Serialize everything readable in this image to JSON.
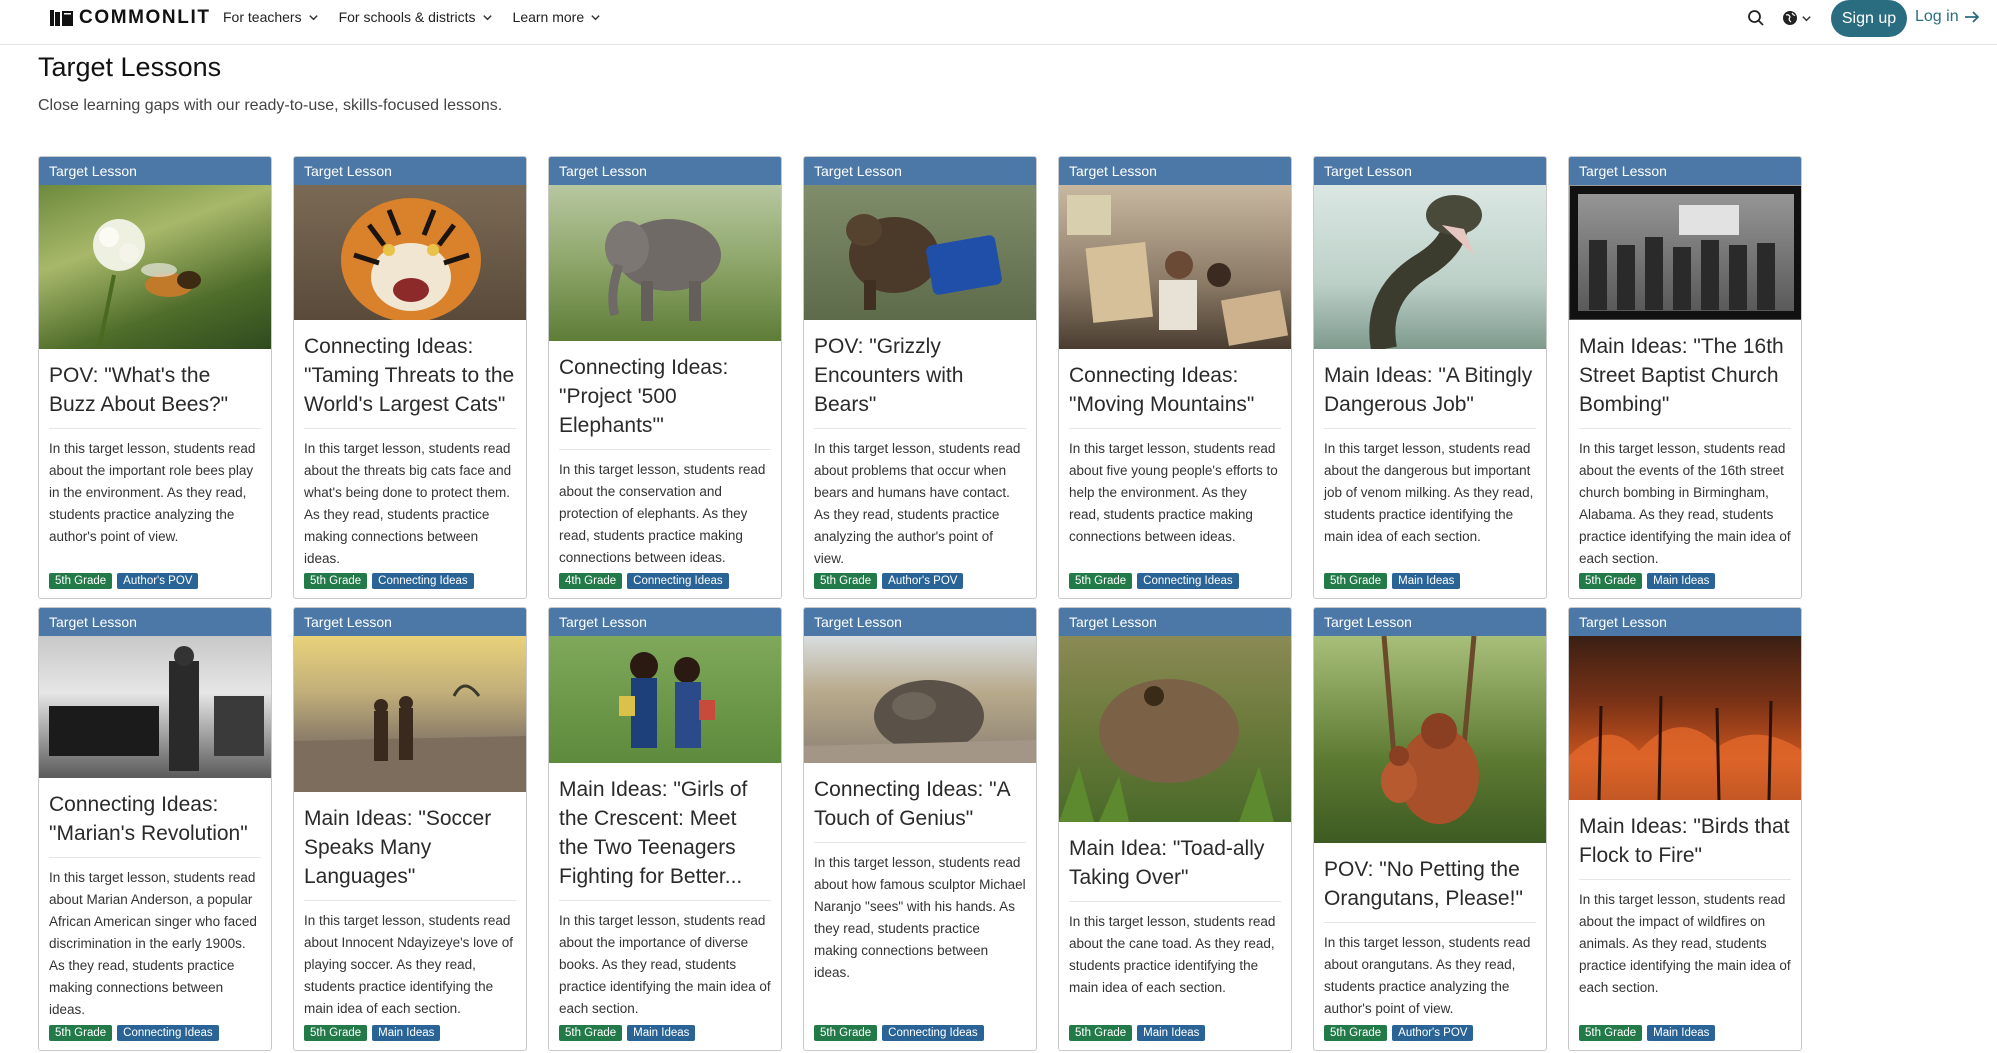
{
  "header": {
    "logo_text": "COMMONLIT",
    "nav": [
      {
        "label": "For teachers"
      },
      {
        "label": "For schools & districts"
      },
      {
        "label": "Learn more"
      }
    ],
    "signup_label": "Sign up",
    "login_label": "Log in"
  },
  "page": {
    "title": "Target Lessons",
    "subtitle": "Close learning gaps with our ready-to-use, skills-focused lessons."
  },
  "colors": {
    "accent": "#2b6d80",
    "card_label_bg": "#4b78a6",
    "grade_tag": "#227a49",
    "skill_tag": "#2a6497"
  },
  "cards": [
    {
      "label": "Target Lesson",
      "title": "POV: \"What's the Buzz About Bees?\"",
      "description": "In this target lesson, students read about the important role bees play in the environment. As they read, students practice analyzing the author's point of view.",
      "grade": "5th Grade",
      "skill": "Author's POV",
      "image": "bee-on-clover"
    },
    {
      "label": "Target Lesson",
      "title": "Connecting Ideas: \"Taming Threats to the World's Largest Cats\"",
      "description": "In this target lesson, students read about the threats big cats face and what's being done to protect them. As they read, students practice making connections between ideas.",
      "grade": "5th Grade",
      "skill": "Connecting Ideas",
      "image": "tiger"
    },
    {
      "label": "Target Lesson",
      "title": "Connecting Ideas: \"Project '500 Elephants'\"",
      "description": "In this target lesson, students read about the conservation and protection of elephants. As they read, students practice making connections between ideas.",
      "grade": "4th Grade",
      "skill": "Connecting Ideas",
      "image": "elephant"
    },
    {
      "label": "Target Lesson",
      "title": "POV: \"Grizzly Encounters with Bears\"",
      "description": "In this target lesson, students read about problems that occur when bears and humans have contact. As they read, students practice analyzing the author's point of view.",
      "grade": "5th Grade",
      "skill": "Author's POV",
      "image": "bear-with-bin"
    },
    {
      "label": "Target Lesson",
      "title": "Connecting Ideas: \"Moving Mountains\"",
      "description": "In this target lesson, students read about five young people's efforts to help the environment. As they read, students practice making connections between ideas.",
      "grade": "5th Grade",
      "skill": "Connecting Ideas",
      "image": "climate-protest"
    },
    {
      "label": "Target Lesson",
      "title": "Main Ideas: \"A Bitingly Dangerous Job\"",
      "description": "In this target lesson, students read about the dangerous but important job of venom milking. As they read, students practice identifying the main idea of each section.",
      "grade": "5th Grade",
      "skill": "Main Ideas",
      "image": "snake"
    },
    {
      "label": "Target Lesson",
      "title": "Main Ideas: \"The 16th Street Baptist Church Bombing\"",
      "description": "In this target lesson, students read about the events of the 16th street church bombing in Birmingham, Alabama. As they read, students practice identifying the main idea of each section.",
      "grade": "5th Grade",
      "skill": "Main Ideas",
      "image": "march-photo"
    },
    {
      "label": "Target Lesson",
      "title": "Connecting Ideas: \"Marian's Revolution\"",
      "description": "In this target lesson, students read about Marian Anderson, a popular African American singer who faced discrimination in the early 1900s. As they read, students practice making connections between ideas.",
      "grade": "5th Grade",
      "skill": "Connecting Ideas",
      "image": "singer-photo"
    },
    {
      "label": "Target Lesson",
      "title": "Main Ideas: \"Soccer Speaks Many Languages\"",
      "description": "In this target lesson, students read about Innocent Ndayizeye's love of playing soccer. As they read, students practice identifying the main idea of each section.",
      "grade": "5th Grade",
      "skill": "Main Ideas",
      "image": "children-walking"
    },
    {
      "label": "Target Lesson",
      "title": "Main Ideas: \"Girls of the Crescent: Meet the Two Teenagers Fighting for Better...",
      "description": "In this target lesson, students read about the importance of diverse books. As they read, students practice identifying the main idea of each section.",
      "grade": "5th Grade",
      "skill": "Main Ideas",
      "image": "two-girls-books"
    },
    {
      "label": "Target Lesson",
      "title": "Connecting Ideas: \"A Touch of Genius\"",
      "description": "In this target lesson, students read about how famous sculptor Michael Naranjo \"sees\" with his hands. As they read, students practice making connections between ideas.",
      "grade": "5th Grade",
      "skill": "Connecting Ideas",
      "image": "sculpture"
    },
    {
      "label": "Target Lesson",
      "title": "Main Idea: \"Toad-ally Taking Over\"",
      "description": "In this target lesson, students read about the cane toad. As they read, students practice identifying the main idea of each section.",
      "grade": "5th Grade",
      "skill": "Main Ideas",
      "image": "toad"
    },
    {
      "label": "Target Lesson",
      "title": "POV: \"No Petting the Orangutans, Please!\"",
      "description": "In this target lesson, students read about orangutans. As they read, students practice analyzing the author's point of view.",
      "grade": "5th Grade",
      "skill": "Author's POV",
      "image": "orangutans"
    },
    {
      "label": "Target Lesson",
      "title": "Main Ideas: \"Birds that Flock to Fire\"",
      "description": "In this target lesson, students read about the impact of wildfires on animals. As they read, students practice identifying the main idea of each section.",
      "grade": "5th Grade",
      "skill": "Main Ideas",
      "image": "wildfire"
    }
  ]
}
